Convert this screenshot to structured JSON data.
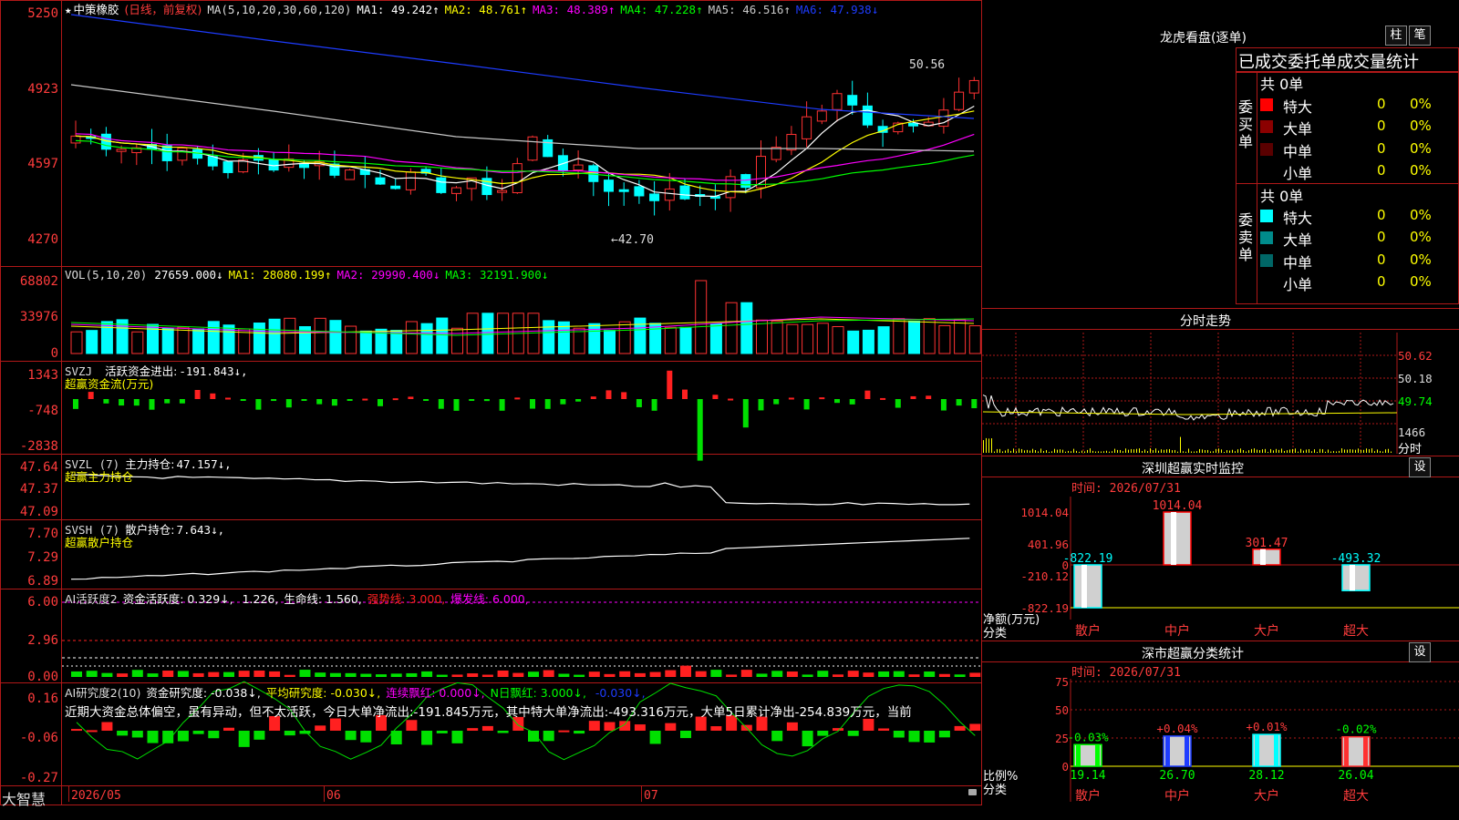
{
  "stock": {
    "star": "★",
    "name": "中策橡胶",
    "mode": "(日线，前复权)"
  },
  "ma_header": {
    "label": "MA(5,10,20,30,60,120)",
    "items": [
      {
        "name": "MA1:",
        "value": "49.242↑",
        "color": "#ffffff"
      },
      {
        "name": "MA2:",
        "value": "48.761↑",
        "color": "#ffff00"
      },
      {
        "name": "MA3:",
        "value": "48.389↑",
        "color": "#ff00ff"
      },
      {
        "name": "MA4:",
        "value": "47.228↑",
        "color": "#00ff00"
      },
      {
        "name": "MA5:",
        "value": "46.516↑",
        "color": "#c8c8c8"
      },
      {
        "name": "MA6:",
        "value": "47.938↓",
        "color": "#1e3cff"
      }
    ]
  },
  "price_axis": [
    "5250",
    "4923",
    "4597",
    "4270"
  ],
  "price_annot": {
    "high": "50.56",
    "low": "←42.70"
  },
  "vol_header": {
    "label": "VOL(5,10,20)",
    "value": "27659.000↓",
    "items": [
      {
        "name": "MA1:",
        "value": "28080.199↑",
        "color": "#ffff00"
      },
      {
        "name": "MA2:",
        "value": "29990.400↓",
        "color": "#ff00ff"
      },
      {
        "name": "MA3:",
        "value": "32191.900↓",
        "color": "#00ff00"
      }
    ]
  },
  "vol_axis": [
    "68802",
    "33976",
    "0"
  ],
  "svzj": {
    "label": "SVZJ",
    "title": "活跃资金进出:",
    "value": "-191.843↓,",
    "sub": "超赢资金流(万元)",
    "axis": [
      "1343",
      "-748",
      "-2838"
    ]
  },
  "svzl": {
    "label": "SVZL (7)",
    "title": "主力持仓:",
    "value": "47.157↓,",
    "sub": "超赢主力持仓",
    "axis": [
      "47.64",
      "47.37",
      "47.09"
    ]
  },
  "svsh": {
    "label": "SVSH (7)",
    "title": "散户持仓:",
    "value": "7.643↓,",
    "sub": "超赢散户持仓",
    "axis": [
      "7.70",
      "7.29",
      "6.89"
    ]
  },
  "ai1": {
    "label": "AI活跃度2",
    "items": [
      {
        "t": "资金活跃度:",
        "v": "0.329↓,",
        "c": "#ffffff"
      },
      {
        "t": "",
        "v": "1.226,",
        "c": "#ffffff"
      },
      {
        "t": "生命线:",
        "v": "1.560,",
        "c": "#ffffff"
      },
      {
        "t": "强势线:",
        "v": "3.000,",
        "c": "#ff2020"
      },
      {
        "t": "爆发线:",
        "v": "6.000,",
        "c": "#ff00ff"
      }
    ],
    "axis": [
      "6.00",
      "2.96",
      "0.00"
    ]
  },
  "ai2": {
    "label": "AI研究度2(10)",
    "items": [
      {
        "t": "资金研究度:",
        "v": "-0.038↓,",
        "c": "#ffffff"
      },
      {
        "t": "平均研究度:",
        "v": "-0.030↓,",
        "c": "#ffff00"
      },
      {
        "t": "连续飘红:",
        "v": "0.000↓,",
        "c": "#ff00ff"
      },
      {
        "t": "N日飘红:",
        "v": "3.000↓,",
        "c": "#00ff00"
      },
      {
        "t": "",
        "v": "-0.030↓,",
        "c": "#1e3cff"
      }
    ],
    "note": "近期大资金总体偏空，虽有异动，但不太活跃，今日大单净流出:-191.845万元，其中特大单净流出:-493.316万元，大单5日累计净出-254.839万元，当前",
    "axis": [
      "0.16",
      "-0.06",
      "-0.27"
    ]
  },
  "x_axis": {
    "logo": "大智慧",
    "labels": [
      "2026/05",
      "06",
      "07"
    ]
  },
  "lhb": {
    "title": "龙虎看盘(逐单)",
    "btn1": "柱",
    "btn2": "笔",
    "sub": "已成交委托单成交量统计",
    "buy": {
      "label": "委买单",
      "total": "共 0单",
      "rows": [
        {
          "name": "特大",
          "v": "0",
          "p": "0%",
          "color": "#ff0000"
        },
        {
          "name": "大单",
          "v": "0",
          "p": "0%",
          "color": "#8b0000"
        },
        {
          "name": "中单",
          "v": "0",
          "p": "0%",
          "color": "#5a0000"
        },
        {
          "name": "小单",
          "v": "0",
          "p": "0%",
          "color": "#000000"
        }
      ]
    },
    "sell": {
      "label": "委卖单",
      "total": "共 0单",
      "rows": [
        {
          "name": "特大",
          "v": "0",
          "p": "0%",
          "color": "#00ffff"
        },
        {
          "name": "大单",
          "v": "0",
          "p": "0%",
          "color": "#008b8b"
        },
        {
          "name": "中单",
          "v": "0",
          "p": "0%",
          "color": "#006666"
        },
        {
          "name": "小单",
          "v": "0",
          "p": "0%",
          "color": "#000000"
        }
      ]
    }
  },
  "intraday": {
    "title": "分时走势",
    "axis": [
      "50.62",
      "50.18",
      "49.74",
      "1466",
      "分时"
    ]
  },
  "sz_monitor": {
    "title": "深圳超赢实时监控",
    "btn": "设",
    "time": "时间: 2026/07/31",
    "axis": [
      "1014.04",
      "401.96",
      "0",
      "-210.12",
      "-822.19"
    ],
    "ylabel1": "净额(万元)",
    "ylabel2": "分类",
    "bars": [
      {
        "cat": "散户",
        "value": -822.19,
        "label": "-822.19",
        "color": "#00ffff"
      },
      {
        "cat": "中户",
        "value": 1014.04,
        "label": "1014.04",
        "color": "#ff0000"
      },
      {
        "cat": "大户",
        "value": 301.47,
        "label": "301.47",
        "color": "#ff0000"
      },
      {
        "cat": "超大",
        "value": -493.32,
        "label": "-493.32",
        "color": "#00ffff"
      }
    ]
  },
  "sz_stats": {
    "title": "深市超赢分类统计",
    "btn": "设",
    "time": "时间: 2026/07/31",
    "axis": [
      "75",
      "50",
      "25",
      "0"
    ],
    "ylabel1": "比例%",
    "ylabel2": "分类",
    "bars": [
      {
        "cat": "散户",
        "value": 19.14,
        "label": "19.14",
        "chg": "-0.03%",
        "chgcolor": "#00ff00",
        "color": "#00ff00"
      },
      {
        "cat": "中户",
        "value": 26.7,
        "label": "26.70",
        "chg": "+0.04%",
        "chgcolor": "#ff3c3c",
        "color": "#1e3cff"
      },
      {
        "cat": "大户",
        "value": 28.12,
        "label": "28.12",
        "chg": "+0.01%",
        "chgcolor": "#ff3c3c",
        "color": "#00ffff"
      },
      {
        "cat": "超大",
        "value": 26.04,
        "label": "26.04",
        "chg": "-0.02%",
        "chgcolor": "#00ff00",
        "color": "#ff3030"
      }
    ]
  }
}
